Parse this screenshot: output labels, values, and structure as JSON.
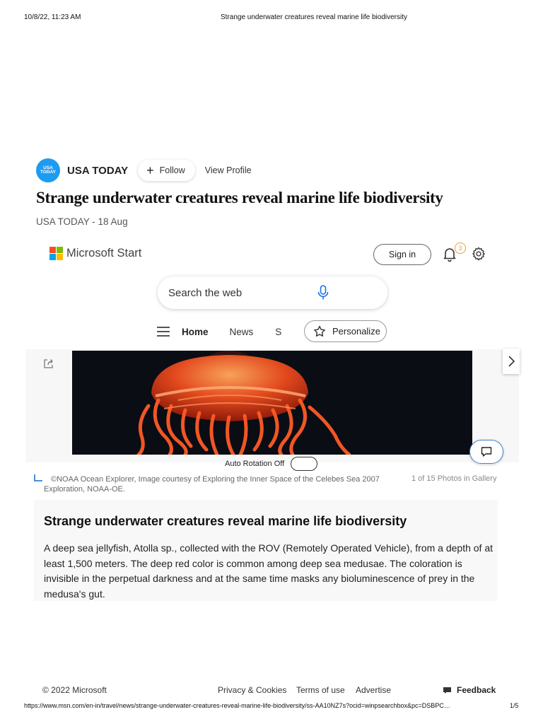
{
  "print_header": {
    "datetime": "10/8/22, 11:23 AM",
    "title": "Strange underwater creatures reveal marine life biodiversity"
  },
  "publisher": {
    "logo_text": "USA TODAY",
    "name": "USA TODAY",
    "follow_label": "Follow",
    "view_profile_label": "View Profile",
    "logo_color": "#1d9bf0"
  },
  "article": {
    "headline": "Strange underwater creatures reveal marine life biodiversity",
    "byline": "USA TODAY - 18 Aug"
  },
  "msn_header": {
    "brand": "Microsoft Start",
    "sign_in_label": "Sign in",
    "notification_count": "3",
    "search_placeholder": "Search the web",
    "icons": [
      "microsoft-logo-icon",
      "bell-icon",
      "gear-icon",
      "microphone-icon"
    ]
  },
  "nav": {
    "home": "Home",
    "news": "News",
    "partial": "S",
    "personalize": "Personalize",
    "icons": [
      "hamburger-icon",
      "personalize-icon"
    ]
  },
  "gallery": {
    "auto_rotation_label": "Auto Rotation Off",
    "auto_rotation_on": false,
    "credit_line1": "©NOAA Ocean Explorer, Image courtesy of Exploring the Inner Space of the Celebes Sea 2007",
    "credit_line2": "Exploration, NOAA-OE.",
    "counter": "1 of 15 Photos in Gallery",
    "icons": [
      "share-icon",
      "chevron-right-icon",
      "comment-icon"
    ]
  },
  "caption": {
    "title": "Strange underwater creatures reveal marine life biodiversity",
    "body": "A deep sea jellyfish, Atolla sp., collected with the ROV (Remotely Operated Vehicle), from a depth of at least 1,500 meters. The deep red color is common among deep sea medusae. The coloration is invisible in the perpetual darkness and at the same time masks any bioluminescence of prey in the medusa's gut."
  },
  "footer": {
    "copyright": "© 2022 Microsoft",
    "privacy": "Privacy & Cookies",
    "terms": "Terms of use",
    "advertise": "Advertise",
    "feedback": "Feedback"
  },
  "print_footer": {
    "url": "https://www.msn.com/en-in/travel/news/strange-underwater-creatures-reveal-marine-life-biodiversity/ss-AA10NZ7s?ocid=winpsearchbox&pc=DSBPC…",
    "page": "1/5"
  },
  "colors": {
    "accent_blue": "#4a90d9",
    "badge_orange": "#f59b2a",
    "jellyfish_red": "#e8381c"
  }
}
